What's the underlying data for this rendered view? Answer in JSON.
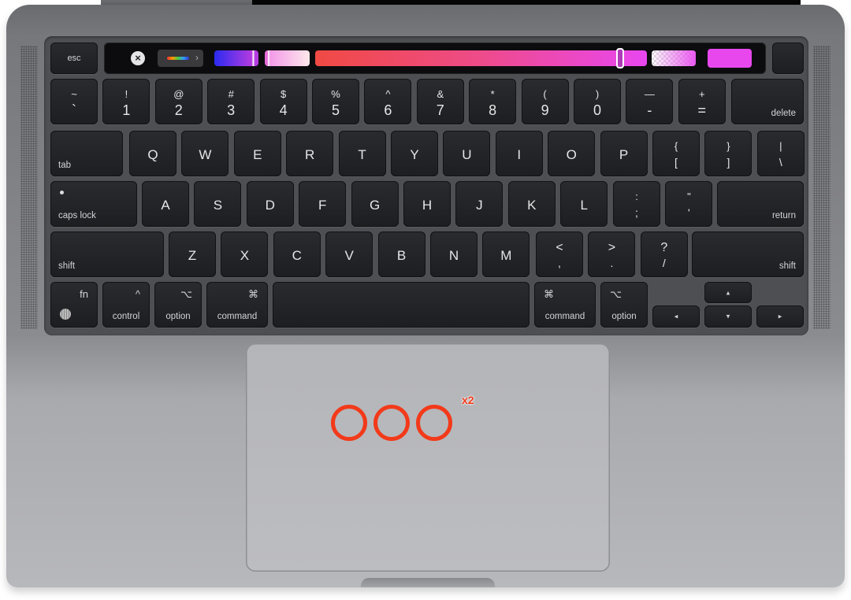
{
  "device": "MacBook keyboard and trackpad",
  "touch_bar": {
    "esc_label": "esc",
    "close_icon": "close-icon",
    "color_picker_icon": "color-spectrum-icon",
    "color_picker_chevron": "›",
    "hue_slider_value": 0.92,
    "current_color": "#e847ee"
  },
  "rows": {
    "number": [
      {
        "top": "~",
        "bottom": "`"
      },
      {
        "top": "!",
        "bottom": "1"
      },
      {
        "top": "@",
        "bottom": "2"
      },
      {
        "top": "#",
        "bottom": "3"
      },
      {
        "top": "$",
        "bottom": "4"
      },
      {
        "top": "%",
        "bottom": "5"
      },
      {
        "top": "^",
        "bottom": "6"
      },
      {
        "top": "&",
        "bottom": "7"
      },
      {
        "top": "*",
        "bottom": "8"
      },
      {
        "top": "(",
        "bottom": "9"
      },
      {
        "top": ")",
        "bottom": "0"
      },
      {
        "top": "—",
        "bottom": "-"
      },
      {
        "top": "+",
        "bottom": "="
      }
    ],
    "delete_label": "delete",
    "tab_label": "tab",
    "qwerty": [
      "Q",
      "W",
      "E",
      "R",
      "T",
      "Y",
      "U",
      "I",
      "O",
      "P"
    ],
    "qwerty_symbols": [
      {
        "top": "{",
        "bottom": "["
      },
      {
        "top": "}",
        "bottom": "]"
      },
      {
        "top": "|",
        "bottom": "\\"
      }
    ],
    "caps_label": "caps lock",
    "asdf": [
      "A",
      "S",
      "D",
      "F",
      "G",
      "H",
      "J",
      "K",
      "L"
    ],
    "asdf_symbols": [
      {
        "top": ":",
        "bottom": ";"
      },
      {
        "top": "\"",
        "bottom": "'"
      }
    ],
    "return_label": "return",
    "shift_label": "shift",
    "zxcv": [
      "Z",
      "X",
      "C",
      "V",
      "B",
      "N",
      "M"
    ],
    "zxcv_symbols": [
      {
        "top": "<",
        "bottom": ","
      },
      {
        "top": ">",
        "bottom": "."
      },
      {
        "top": "?",
        "bottom": "/"
      }
    ],
    "bottom": {
      "fn": "fn",
      "control": "control",
      "control_glyph": "^",
      "option": "option",
      "option_glyph": "⌥",
      "command": "command",
      "command_glyph": "⌘",
      "arrow_left": "◂",
      "arrow_up": "▴",
      "arrow_down": "▾",
      "arrow_right": "▸"
    }
  },
  "trackpad": {
    "gesture": "three-finger tap",
    "finger_count": 3,
    "tap_count_label": "x2",
    "indicator_color": "#f23a1a"
  }
}
